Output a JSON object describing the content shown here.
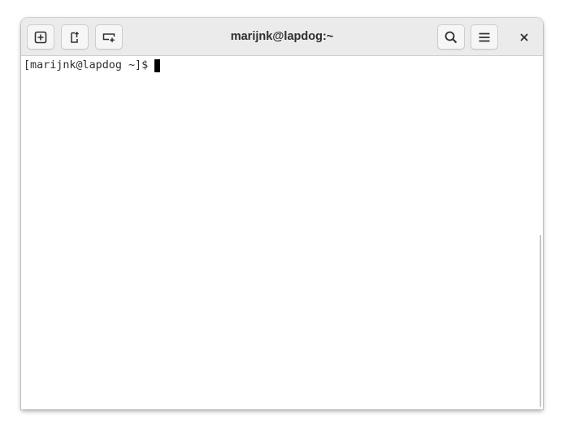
{
  "window": {
    "title": "marijnk@lapdog:~"
  },
  "headerbar": {
    "buttons": [
      {
        "name": "new-tab",
        "icon": "new-tab-icon"
      },
      {
        "name": "detach-tab",
        "icon": "detach-tab-icon"
      },
      {
        "name": "new-window",
        "icon": "new-window-icon"
      },
      {
        "name": "search",
        "icon": "search-icon"
      },
      {
        "name": "menu",
        "icon": "hamburger-menu-icon"
      },
      {
        "name": "close",
        "icon": "close-icon"
      }
    ]
  },
  "terminal": {
    "prompt": "[marijnk@lapdog ~]$"
  },
  "colors": {
    "headerbar_bg": "#ebebeb",
    "terminal_bg": "#ffffff",
    "text": "#2e2e2e",
    "cursor": "#000000"
  }
}
